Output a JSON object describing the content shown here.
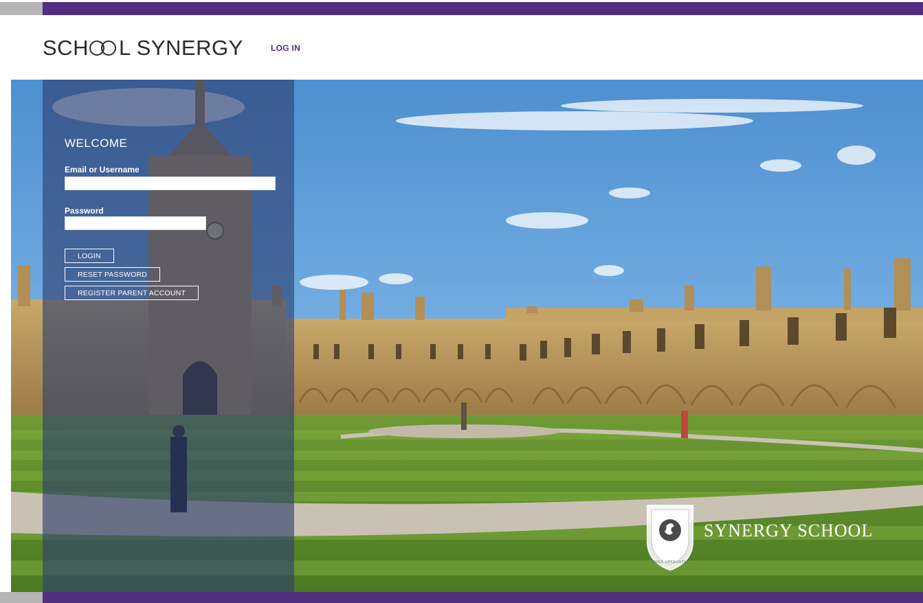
{
  "header": {
    "brand_left": "SCH",
    "brand_right": "L SYNERGY",
    "nav_login": "LOG IN"
  },
  "login_panel": {
    "title": "WELCOME",
    "email_label": "Email or Username",
    "email_value": "",
    "password_label": "Password",
    "password_value": "",
    "buttons": {
      "login": "LOGIN",
      "reset": "RESET PASSWORD",
      "register": "REGISTER PARENT ACCOUNT"
    }
  },
  "school_badge": {
    "name": "SYNERGY SCHOOL",
    "motto": "SIMUL OPERANTES"
  },
  "colors": {
    "brand_purple": "#522d80",
    "panel_overlay": "#2d3e6e",
    "sky": "#6aa7dc",
    "grass": "#5e8a2e",
    "stone": "#b8965e"
  }
}
